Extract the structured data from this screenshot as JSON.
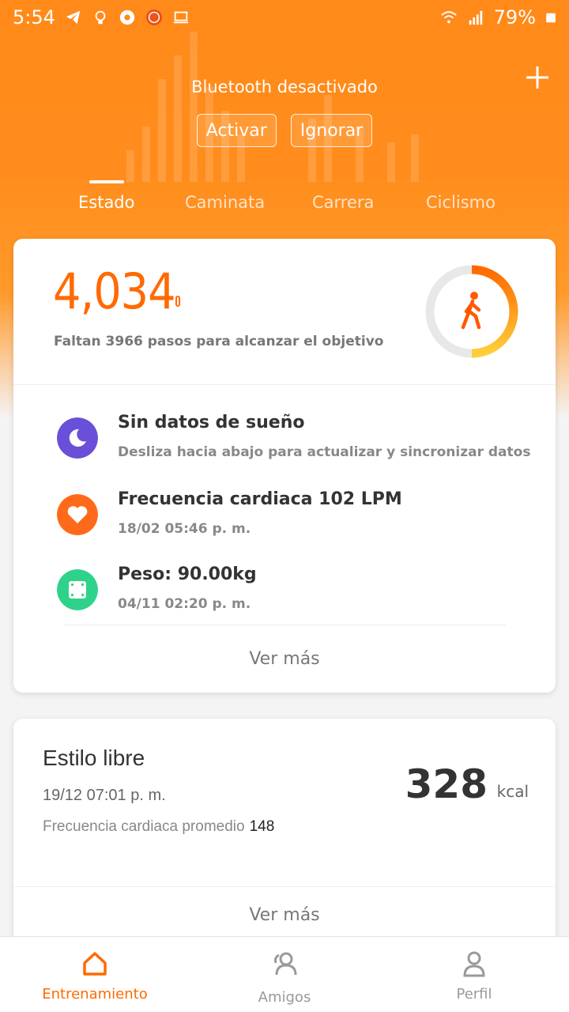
{
  "status_bar": {
    "time": "5:54",
    "battery": "79%",
    "icons_left": [
      "telegram-icon",
      "bulb-icon",
      "circle-app-icon",
      "mi-icon",
      "laptop-icon"
    ],
    "icons_right": [
      "wifi-icon",
      "signal-icon",
      "battery-icon"
    ]
  },
  "bluetooth_banner": {
    "message": "Bluetooth desactivado",
    "activate_label": "Activar",
    "ignore_label": "Ignorar"
  },
  "tabs": [
    {
      "label": "Estado",
      "active": true
    },
    {
      "label": "Caminata",
      "active": false
    },
    {
      "label": "Carrera",
      "active": false
    },
    {
      "label": "Ciclismo",
      "active": false
    }
  ],
  "steps_card": {
    "steps": "4,034",
    "remaining_text": "Faltan 3966 pasos para alcanzar el objetivo",
    "progress_fraction": 0.5
  },
  "info_items": [
    {
      "title": "Sin datos de sueño",
      "subtitle": "Desliza hacia abajo para actualizar y sincronizar datos",
      "icon": "moon-icon",
      "color": "#6a4fd8"
    },
    {
      "title": "Frecuencia cardiaca 102 LPM",
      "subtitle": "18/02 05:46 p. m.",
      "icon": "heart-icon",
      "color": "#ff6a1a"
    },
    {
      "title": "Peso: 90.00kg",
      "subtitle": "04/11 02:20 p. m.",
      "icon": "scale-icon",
      "color": "#2fd28a"
    }
  ],
  "see_more_label": "Ver más",
  "workout_card": {
    "title": "Estilo libre",
    "date": "19/12 07:01 p. m.",
    "hr_label": "Frecuencia cardiaca promedio",
    "hr_value": "148",
    "kcal_value": "328",
    "kcal_unit": "kcal",
    "see_more_label": "Ver más"
  },
  "bottom_nav": [
    {
      "label": "Entrenamiento",
      "icon": "home-icon",
      "active": true
    },
    {
      "label": "Amigos",
      "icon": "friends-icon",
      "active": false
    },
    {
      "label": "Perfil",
      "icon": "profile-icon",
      "active": false
    }
  ],
  "colors": {
    "accent": "#ff6a00",
    "hero_orange": "#ff8a1a"
  }
}
